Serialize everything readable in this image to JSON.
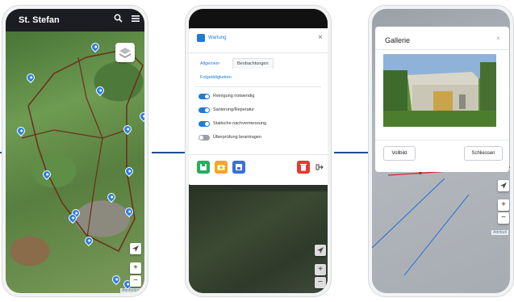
{
  "phone1": {
    "app_title": "St. Stefan",
    "icons": [
      "search-icon",
      "menu-icon",
      "layers-icon",
      "locate-icon"
    ],
    "zoom_in": "+",
    "zoom_out": "−",
    "attribution": "Attribution"
  },
  "phone2": {
    "modal_title": "Wartung",
    "tabs": [
      "Allgemein",
      "Beobachtungen",
      "Folgetätigkeiten"
    ],
    "toggles": [
      {
        "label": "Reinigung notwendig",
        "on": true
      },
      {
        "label": "Sanierung/Reperatur",
        "on": true
      },
      {
        "label": "Statische nachvermessung",
        "on": true
      },
      {
        "label": "Überprüfung beantragen",
        "on": false
      }
    ],
    "action_icons": [
      "save-icon",
      "camera-icon",
      "disk-icon",
      "delete-icon",
      "exit-icon"
    ],
    "zoom_in": "+",
    "zoom_out": "−",
    "colors": {
      "accent": "#1e7bd6",
      "save": "#27ae60",
      "camera": "#f5a623",
      "disk": "#3b6fd8",
      "delete": "#e53935"
    }
  },
  "phone3": {
    "gallery_title": "Gallerie",
    "fullscreen_button": "Vollbild",
    "close_button": "Schliessen",
    "zoom_in": "+",
    "zoom_out": "−",
    "attribution": "Attributi"
  }
}
